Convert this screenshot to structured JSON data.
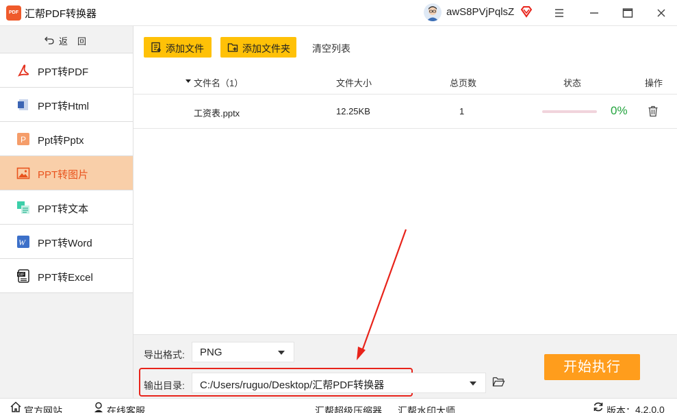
{
  "app": {
    "logo_text": "PDF",
    "title": "汇帮PDF转换器"
  },
  "user": {
    "name": "awS8PVjPqlsZ"
  },
  "window_controls": {
    "menu_icon": "menu-icon",
    "minimize_icon": "minimize-icon",
    "maximize_icon": "maximize-icon",
    "close_icon": "close-icon"
  },
  "sidebar": {
    "back_label": "返回",
    "items": [
      {
        "label": "PPT转PDF",
        "icon": "pdf-icon",
        "active": false
      },
      {
        "label": "PPT转Html",
        "icon": "html-icon",
        "active": false
      },
      {
        "label": "Ppt转Pptx",
        "icon": "pptx-icon",
        "active": false
      },
      {
        "label": "PPT转图片",
        "icon": "image-icon",
        "active": true
      },
      {
        "label": "PPT转文本",
        "icon": "text-icon",
        "active": false
      },
      {
        "label": "PPT转Word",
        "icon": "word-icon",
        "active": false
      },
      {
        "label": "PPT转Excel",
        "icon": "excel-icon",
        "active": false
      }
    ]
  },
  "toolbar": {
    "add_file": "添加文件",
    "add_folder": "添加文件夹",
    "clear_list": "清空列表"
  },
  "table": {
    "headers": {
      "filename": "文件名（1）",
      "size": "文件大小",
      "pages": "总页数",
      "status": "状态",
      "actions": "操作"
    },
    "rows": [
      {
        "filename": "工资表.pptx",
        "size": "12.25KB",
        "pages": "1",
        "progress_text": "0%",
        "progress": 0
      }
    ]
  },
  "settings": {
    "format_label": "导出格式:",
    "format_value": "PNG",
    "dir_label": "输出目录:",
    "dir_value": "C:/Users/ruguo/Desktop/汇帮PDF转换器",
    "start_button": "开始执行"
  },
  "footer": {
    "website": "官方网站",
    "support": "在线客服",
    "compressor": "汇帮超级压缩器",
    "watermark": "汇帮水印大师",
    "version_label": "版本：",
    "version": "4.2.0.0"
  },
  "colors": {
    "accent": "#ff9d1c",
    "active_nav_bg": "#f9cfa9",
    "active_nav_text": "#e9531d",
    "button_yellow": "#ffc107",
    "progress_text": "#22a33d",
    "highlight_box": "#e8231a"
  }
}
